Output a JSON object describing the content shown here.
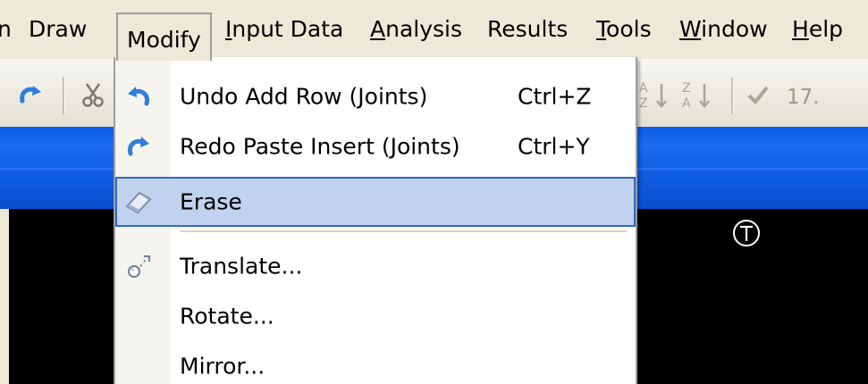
{
  "menubar": {
    "items": [
      {
        "label": "n"
      },
      {
        "label": "Draw"
      },
      {
        "label": "Modify"
      },
      {
        "pre": "",
        "mn": "I",
        "post": "nput Data"
      },
      {
        "pre": "",
        "mn": "A",
        "post": "nalysis"
      },
      {
        "label": "Results"
      },
      {
        "pre": "",
        "mn": "T",
        "post": "ools"
      },
      {
        "pre": "",
        "mn": "W",
        "post": "indow"
      },
      {
        "pre": "",
        "mn": "H",
        "post": "elp"
      }
    ]
  },
  "toolbar": {
    "value_text": "17."
  },
  "modify_menu": {
    "items": [
      {
        "label": "Undo Add Row (Joints)",
        "shortcut": "Ctrl+Z",
        "icon": "undo-icon"
      },
      {
        "label": "Redo Paste Insert (Joints)",
        "shortcut": "Ctrl+Y",
        "icon": "redo-icon"
      },
      {
        "label": "Erase",
        "shortcut": "",
        "icon": "eraser-icon"
      },
      {
        "label": "Translate...",
        "shortcut": "",
        "icon": "translate-icon"
      },
      {
        "label": "Rotate...",
        "shortcut": ""
      },
      {
        "label": "Mirror...",
        "shortcut": ""
      }
    ]
  },
  "viewport": {
    "icon": "view-top-icon"
  },
  "colors": {
    "title_bar": "#0a5ae6",
    "highlight": "#c1d2ee",
    "highlight_border": "#316ac5",
    "canvas": "#000000"
  }
}
